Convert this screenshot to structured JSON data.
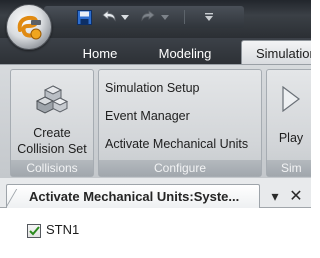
{
  "tabs": [
    {
      "label": "Home"
    },
    {
      "label": "Modeling"
    },
    {
      "label": "Simulation"
    }
  ],
  "ribbon": {
    "collisions": {
      "create_label_line1": "Create",
      "create_label_line2": "Collision Set",
      "footer": "Collisions"
    },
    "configure": {
      "items": [
        {
          "label": "Simulation Setup"
        },
        {
          "label": "Event Manager"
        },
        {
          "label": "Activate Mechanical Units"
        }
      ],
      "footer": "Configure"
    },
    "sim": {
      "play_label": "Play",
      "footer": "Sim"
    }
  },
  "panel": {
    "title": "Activate Mechanical Units:Syste...",
    "pin_glyph": "▾",
    "close_glyph": "✕",
    "items": [
      {
        "label": "STN1",
        "checked": true
      }
    ]
  },
  "colors": {
    "titlebar": "#2b2f34",
    "ribbon": "#d2d5d8",
    "group_footer": "#a1a7ad",
    "active_tab": "#e8eaec"
  },
  "icons": [
    "app-orb-icon",
    "save-icon",
    "undo-icon",
    "redo-icon",
    "customize-qat-icon",
    "collision-set-icon",
    "play-icon",
    "pin-dropdown-icon",
    "close-icon",
    "checkmark-icon"
  ]
}
